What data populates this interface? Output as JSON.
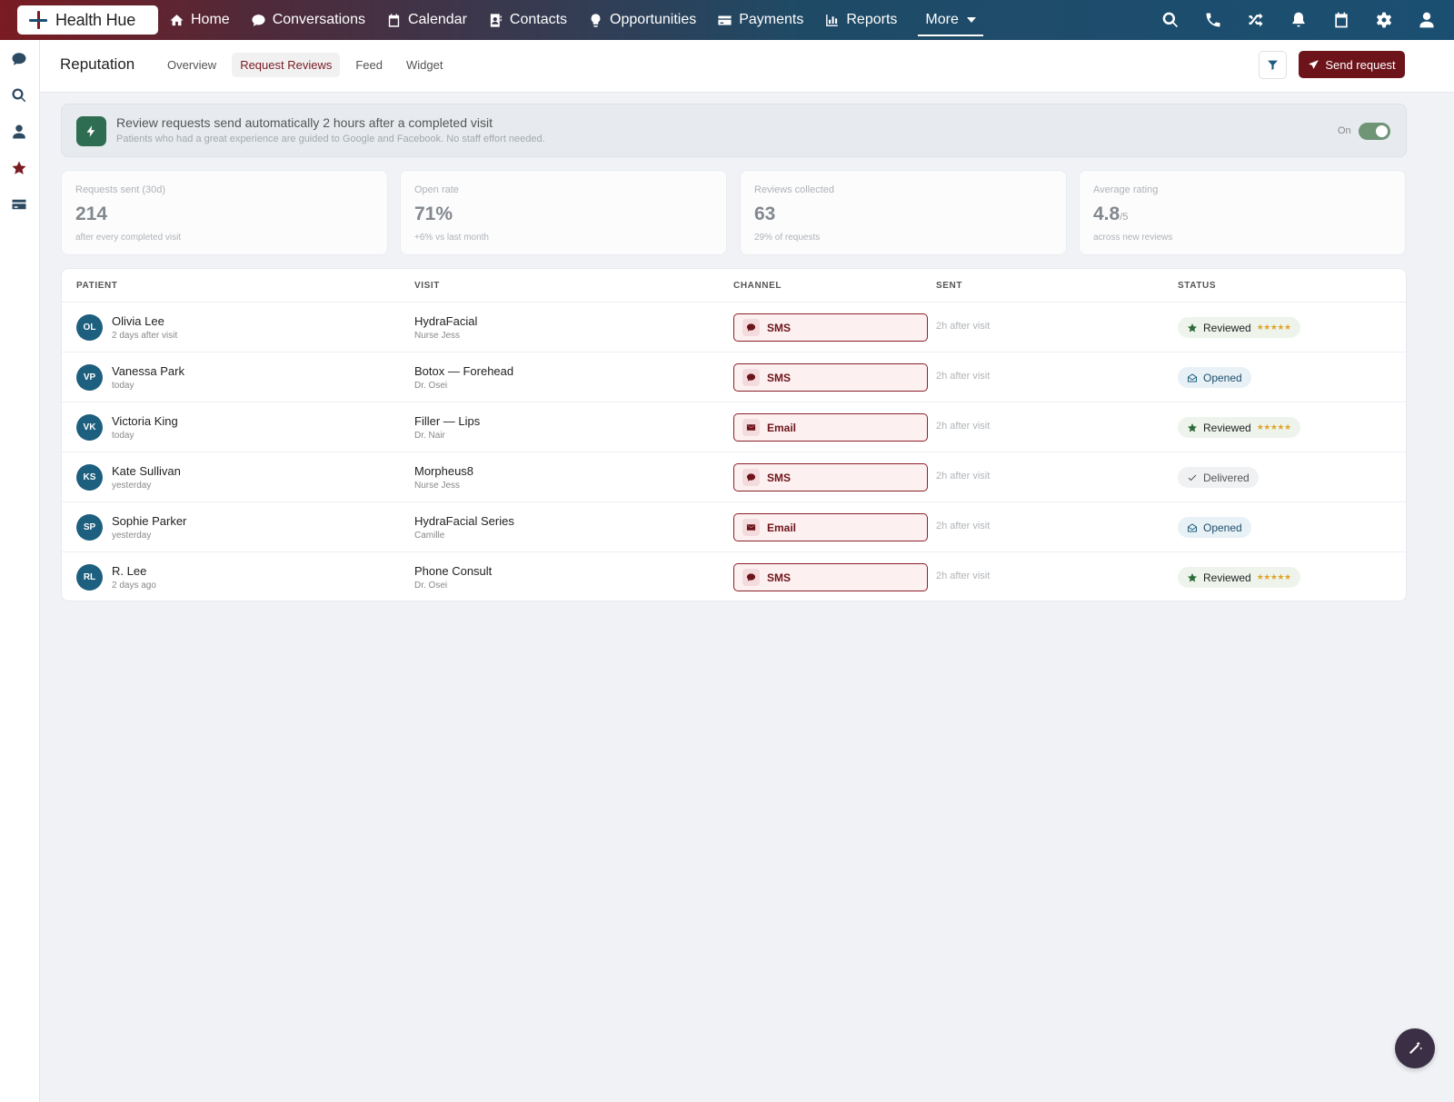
{
  "app": {
    "name": "Health Hue"
  },
  "nav": {
    "items": [
      {
        "label": "Home",
        "icon": "home-icon"
      },
      {
        "label": "Conversations",
        "icon": "chat-icon"
      },
      {
        "label": "Calendar",
        "icon": "calendar-icon"
      },
      {
        "label": "Contacts",
        "icon": "contacts-icon"
      },
      {
        "label": "Opportunities",
        "icon": "lightbulb-icon"
      },
      {
        "label": "Payments",
        "icon": "credit-card-icon"
      },
      {
        "label": "Reports",
        "icon": "bar-chart-icon"
      }
    ],
    "more_label": "More",
    "right_icons": [
      "search-icon",
      "phone-icon",
      "shuffle-icon",
      "bell-icon",
      "calendar-icon",
      "gear-icon",
      "user-icon"
    ]
  },
  "sidebar": {
    "icons": [
      "chat-icon",
      "search-icon",
      "user-icon",
      "star-icon",
      "card-icon"
    ]
  },
  "page": {
    "title": "Reputation",
    "tabs": [
      "Overview",
      "Request Reviews",
      "Feed",
      "Widget"
    ],
    "active_tab": "Request Reviews",
    "send_button": "Send request"
  },
  "banner": {
    "title": "Review requests send automatically 2 hours after a completed visit",
    "subtitle": "Patients who had a great experience are guided to Google and Facebook. No staff effort needed.",
    "toggle_label": "On",
    "toggle_on": true
  },
  "stats": [
    {
      "label": "Requests sent (30d)",
      "value": "214",
      "suffix": "",
      "sub": "after every completed visit"
    },
    {
      "label": "Open rate",
      "value": "71%",
      "suffix": "",
      "sub": "+6% vs last month"
    },
    {
      "label": "Reviews collected",
      "value": "63",
      "suffix": "",
      "sub": "29% of requests"
    },
    {
      "label": "Average rating",
      "value": "4.8",
      "suffix": "/5",
      "sub": "across new reviews"
    }
  ],
  "table": {
    "headers": [
      "PATIENT",
      "VISIT",
      "CHANNEL",
      "SENT",
      "STATUS"
    ],
    "rows": [
      {
        "initials": "OL",
        "name": "Olivia Lee",
        "when": "2 days after visit",
        "visit": "HydraFacial",
        "provider": "Nurse Jess",
        "channel": "SMS",
        "sent": "2h after visit",
        "status": "Reviewed",
        "stars": "★★★★★"
      },
      {
        "initials": "VP",
        "name": "Vanessa Park",
        "when": "today",
        "visit": "Botox — Forehead",
        "provider": "Dr. Osei",
        "channel": "SMS",
        "sent": "2h after visit",
        "status": "Opened",
        "stars": ""
      },
      {
        "initials": "VK",
        "name": "Victoria King",
        "when": "today",
        "visit": "Filler — Lips",
        "provider": "Dr. Nair",
        "channel": "Email",
        "sent": "2h after visit",
        "status": "Reviewed",
        "stars": "★★★★★"
      },
      {
        "initials": "KS",
        "name": "Kate Sullivan",
        "when": "yesterday",
        "visit": "Morpheus8",
        "provider": "Nurse Jess",
        "channel": "SMS",
        "sent": "2h after visit",
        "status": "Delivered",
        "stars": ""
      },
      {
        "initials": "SP",
        "name": "Sophie Parker",
        "when": "yesterday",
        "visit": "HydraFacial Series",
        "provider": "Camille",
        "channel": "Email",
        "sent": "2h after visit",
        "status": "Opened",
        "stars": ""
      },
      {
        "initials": "RL",
        "name": "R. Lee",
        "when": "2 days ago",
        "visit": "Phone Consult",
        "provider": "Dr. Osei",
        "channel": "SMS",
        "sent": "2h after visit",
        "status": "Reviewed",
        "stars": "★★★★★"
      }
    ]
  }
}
